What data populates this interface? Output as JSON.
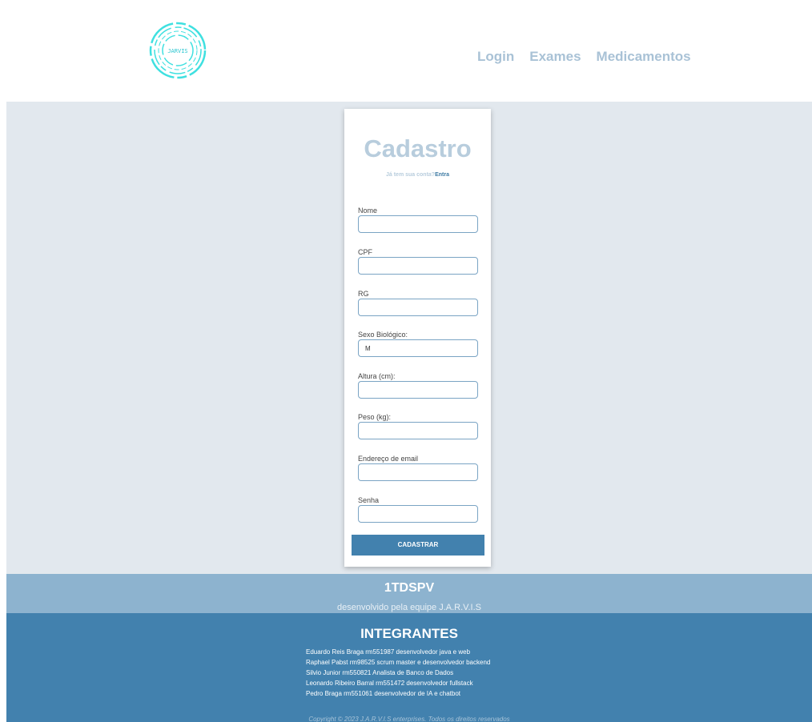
{
  "header": {
    "logo_text": "JARVIS",
    "nav": [
      "Login",
      "Exames",
      "Medicamentos"
    ]
  },
  "form": {
    "title": "Cadastro",
    "subtitle_text": "Já tem sua conta?",
    "subtitle_link": "Entra",
    "fields": [
      {
        "label": "Nome",
        "value": ""
      },
      {
        "label": "CPF",
        "value": ""
      },
      {
        "label": "RG",
        "value": ""
      },
      {
        "label": "Sexo Biológico:",
        "value": "M"
      },
      {
        "label": "Altura (cm):",
        "value": ""
      },
      {
        "label": "Peso (kg):",
        "value": ""
      },
      {
        "label": "Endereço de email",
        "value": ""
      },
      {
        "label": "Senha",
        "value": ""
      }
    ],
    "submit_label": "CADASTRAR"
  },
  "footer": {
    "team": "1TDSPV",
    "description": "desenvolvido pela equipe J.A.R.V.I.S",
    "members_heading": "INTEGRANTES",
    "members": [
      "Eduardo Reis Braga rm551987 desenvolvedor java e web",
      "Raphael Pabst rm98525 scrum master e desenvolvedor backend",
      "Silvio Junior rm550821 Analista de Banco de Dados",
      "Leonardo Ribeiro Barral rm551472 desenvolvedor fullstack",
      "Pedro Braga rm551061 desenvolvedor de IA e chatbot"
    ],
    "copyright": "Copyright © 2023 J.A.R.V.I.S enterprises. Todos os direitos reservados"
  },
  "colors": {
    "primary": "#4281ae",
    "light_blue": "#8db3cf",
    "title": "#b8cddd",
    "background": "#e2e8ee",
    "logo": "#3fe0e0"
  }
}
